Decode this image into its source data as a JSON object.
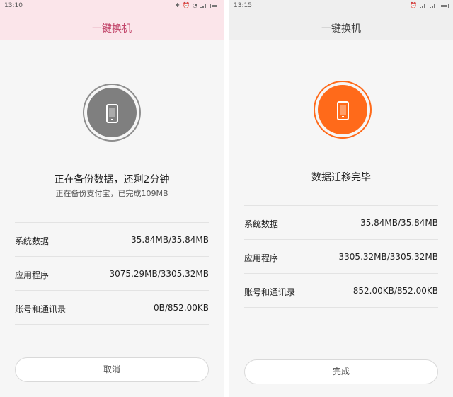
{
  "left": {
    "status": {
      "time": "13:10"
    },
    "title": "一键换机",
    "headline": "正在备份数据，还剩2分钟",
    "subline": "正在备份支付宝，已完成109MB",
    "rows": [
      {
        "label": "系统数据",
        "value": "35.84MB/35.84MB"
      },
      {
        "label": "应用程序",
        "value": "3075.29MB/3305.32MB"
      },
      {
        "label": "账号和通讯录",
        "value": "0B/852.00KB"
      }
    ],
    "button_label": "取消",
    "accent": "#7f7f7f",
    "title_color": "#c2456a"
  },
  "right": {
    "status": {
      "time": "13:15"
    },
    "title": "一键换机",
    "headline": "数据迁移完毕",
    "rows": [
      {
        "label": "系统数据",
        "value": "35.84MB/35.84MB"
      },
      {
        "label": "应用程序",
        "value": "3305.32MB/3305.32MB"
      },
      {
        "label": "账号和通讯录",
        "value": "852.00KB/852.00KB"
      }
    ],
    "button_label": "完成",
    "accent": "#ff6a1a"
  },
  "icons": {
    "status": [
      "bluetooth-icon",
      "alarm-icon",
      "wifi-icon",
      "signal-icon",
      "battery-icon"
    ],
    "center": "phone-icon"
  }
}
